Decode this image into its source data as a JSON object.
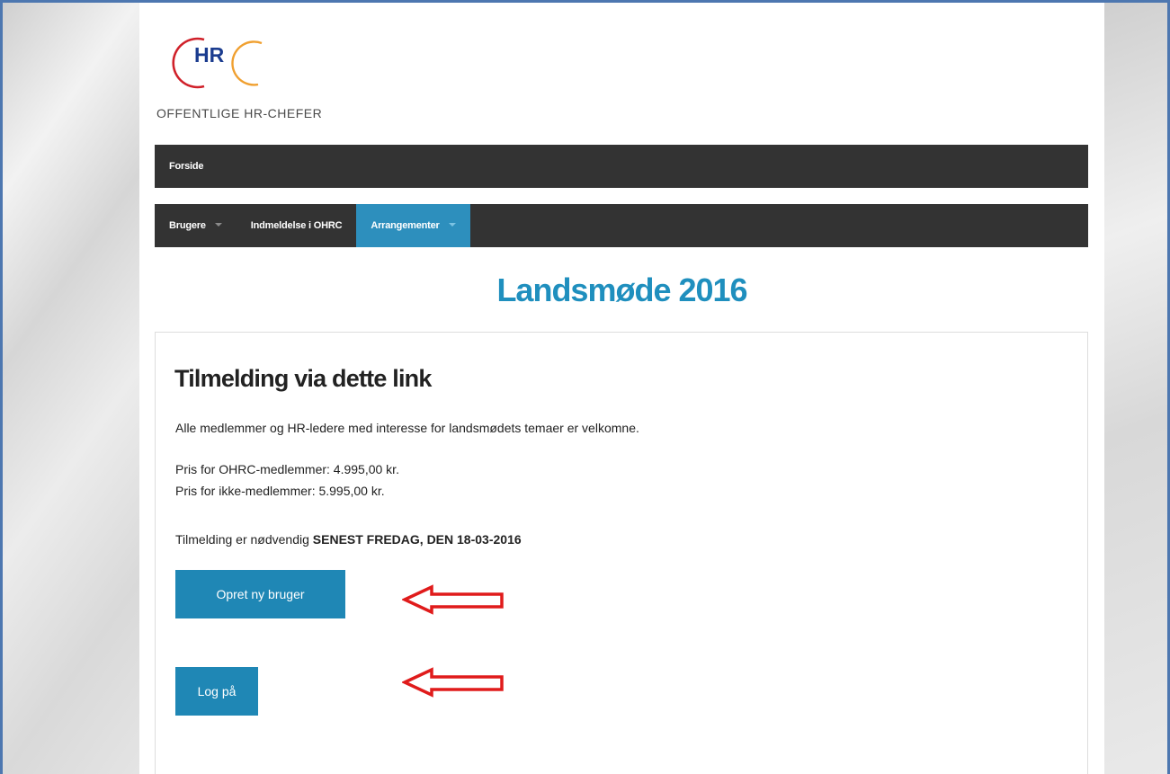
{
  "logo": {
    "mark": "HR",
    "tagline": "OFFENTLIGE HR-CHEFER"
  },
  "nav_primary": {
    "items": [
      {
        "label": "Forside"
      }
    ]
  },
  "nav_secondary": {
    "items": [
      {
        "label": "Brugere",
        "has_dropdown": true,
        "active": false
      },
      {
        "label": "Indmeldelse i OHRC",
        "has_dropdown": false,
        "active": false
      },
      {
        "label": "Arrangementer",
        "has_dropdown": true,
        "active": true
      }
    ]
  },
  "page": {
    "title": "Landsmøde 2016"
  },
  "panel": {
    "heading": "Tilmelding via dette link",
    "intro": "Alle medlemmer og HR-ledere med interesse for landsmødets temaer er velkomne.",
    "price_members": "Pris for OHRC-medlemmer: 4.995,00 kr.",
    "price_nonmembers": "Pris for ikke-medlemmer: 5.995,00 kr.",
    "deadline_prefix": "Tilmelding er nødvendig",
    "deadline_emphasis": "SENEST FREDAG, DEN 18-03-2016",
    "create_user_label": "Opret ny bruger",
    "login_label": "Log på"
  },
  "colors": {
    "nav_bg": "#333333",
    "accent": "#1f87b5",
    "title": "#1f8fbe",
    "annotation_arrow": "#e01b1b",
    "logo_red": "#d0212a",
    "logo_orange": "#f0a030",
    "logo_blue": "#1b3c8f"
  },
  "icons": [
    "caret-down-icon",
    "arrow-left-annotation-icon"
  ]
}
